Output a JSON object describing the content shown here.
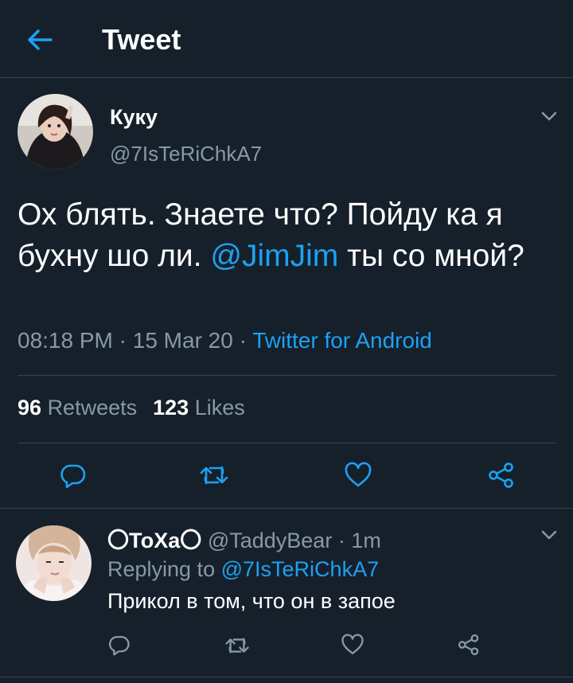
{
  "header": {
    "title": "Tweet",
    "back_icon": "arrow-left-icon"
  },
  "colors": {
    "background": "#15202b",
    "accent": "#1da1f2",
    "muted": "#8899a6",
    "divider": "#38444d"
  },
  "tweet": {
    "name": "Куку",
    "handle": "@7IsTeRiChkA7",
    "text_part1": "Ох блять. Знаете что? Пойду ка я бухну шо ли. ",
    "mention": "@JimJim",
    "text_part2": " ты со мной?",
    "time": "08:18 PM",
    "date": "15 Mar 20",
    "source": "Twitter for Android",
    "retweets_count": "96",
    "retweets_label": "Retweets",
    "likes_count": "123",
    "likes_label": "Likes"
  },
  "reply": {
    "name": "〇ТоХа〇",
    "handle": "@TaddyBear",
    "time": "1m",
    "replying_to_label": "Replying to",
    "replying_to_handle": "@7IsTeRiChkA7",
    "text": "Прикол в том, что он в запое"
  },
  "actions": [
    "reply-icon",
    "retweet-icon",
    "like-icon",
    "share-icon"
  ]
}
